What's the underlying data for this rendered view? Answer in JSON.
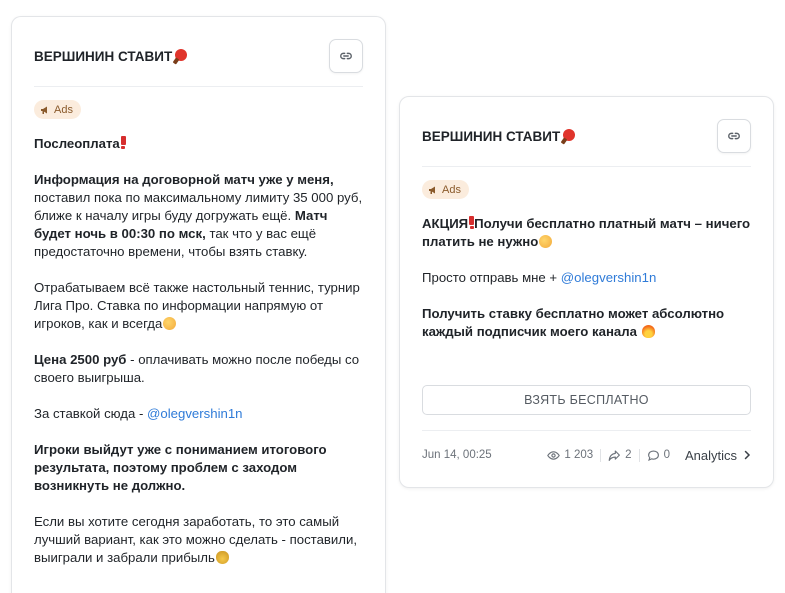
{
  "left_post": {
    "channel_name": "ВЕРШИНИН СТАВИТ",
    "badge": "Ads",
    "p1": "Послеоплата",
    "p2_bold": "Информация на договорной матч уже у меня,",
    "p2_text": " поставил пока по максимальному лимиту 35 000 руб, ближе к началу игры буду догружать ещё. ",
    "p2_bold2": "Матч будет ночь в 00:30 по мск,",
    "p2_text2": " так что у вас ещё предостаточно времени, чтобы взять ставку.",
    "p3": "Отрабатываем всё также настольный теннис, турнир Лига Про. Ставка по информации напрямую от игроков, как и всегда",
    "p4_bold": "Цена 2500 руб",
    "p4_text": " - оплачивать можно после победы со своего выигрыша.",
    "p5_text": "За ставкой сюда - ",
    "p5_link": "@olegvershin1n",
    "p6_bold": "Игроки выйдут уже с пониманием итогового результата, поэтому проблем с заходом возникнуть не должно.",
    "p7": "Если вы хотите сегодня заработать, то это самый лучший вариант, как это можно сделать - поставили, выиграли и забрали прибыль"
  },
  "right_post": {
    "channel_name": "ВЕРШИНИН СТАВИТ",
    "badge": "Ads",
    "p1_bold_a": "АКЦИЯ",
    "p1_bold_b": "Получи бесплатно платный матч – ничего платить не нужно",
    "p2_text": "Просто отправь мне + ",
    "p2_link": "@olegvershin1n",
    "p3_bold": "Получить ставку бесплатно может абсолютно каждый подписчик моего канала",
    "cta_label": "ВЗЯТЬ БЕСПЛАТНО",
    "date": "Jun 14, 00:25",
    "views": "1 203",
    "shares": "2",
    "comments": "0",
    "analytics_label": "Analytics"
  },
  "colors": {
    "link": "#2f7bd8",
    "badge_bg": "#fbecdd",
    "badge_text": "#8a5a2b",
    "border": "#e3e5e8"
  },
  "icons": [
    "link-icon",
    "megaphone-icon",
    "eye-icon",
    "share-icon",
    "comment-icon",
    "chevron-right-icon",
    "ping-pong-icon"
  ]
}
